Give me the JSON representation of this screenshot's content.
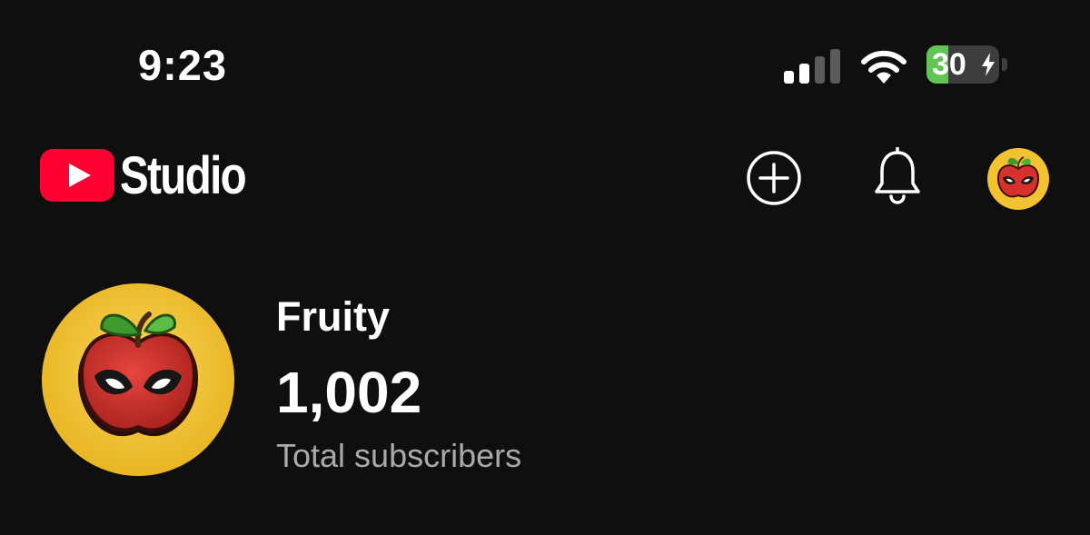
{
  "status_bar": {
    "time": "9:23",
    "battery_level": "30",
    "battery_charging": true,
    "signal_bars_active": 2,
    "signal_bars_total": 4,
    "icons": [
      "cellular-signal-icon",
      "wifi-icon",
      "battery-charging-icon"
    ]
  },
  "header": {
    "app_name": "Studio",
    "logo_icon": "youtube-logo-icon",
    "brand_color": "#ff0000",
    "actions": {
      "create_icon": "plus-circle-icon",
      "notifications_icon": "bell-icon",
      "account_icon": "avatar-icon"
    }
  },
  "channel": {
    "name": "Fruity",
    "subscriber_count": "1,002",
    "subscriber_label": "Total subscribers",
    "avatar_bg_color": "#f2c230",
    "avatar_fruit_color": "#d6312d"
  },
  "colors": {
    "background": "#0f0f0f",
    "text_primary": "#ffffff",
    "text_secondary": "#aaaaaa",
    "battery_fill": "#61c454"
  }
}
